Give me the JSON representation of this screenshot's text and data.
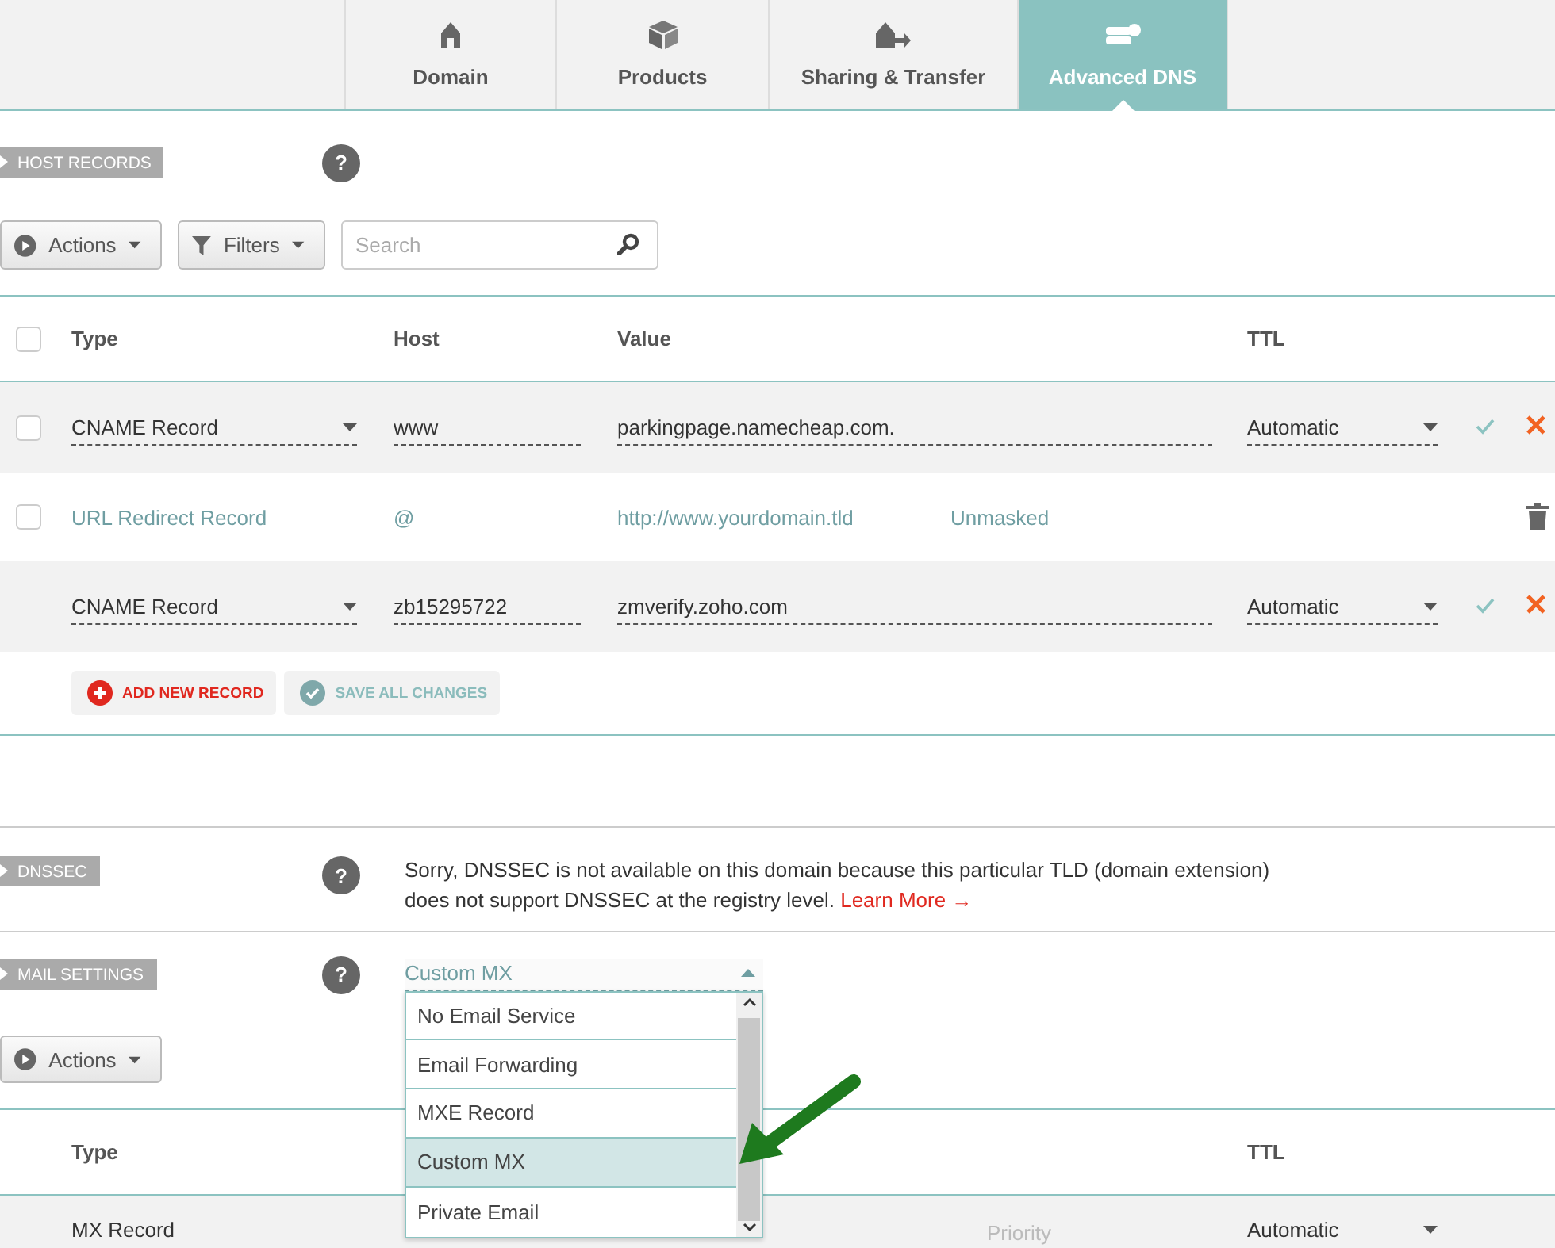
{
  "tabs": [
    {
      "label": "Domain",
      "selected": false
    },
    {
      "label": "Products",
      "selected": false
    },
    {
      "label": "Sharing & Transfer",
      "selected": false
    },
    {
      "label": "Advanced DNS",
      "selected": true
    }
  ],
  "host_records": {
    "title": "HOST RECORDS",
    "help": "?",
    "actions_button": "Actions",
    "filters_button": "Filters",
    "search": {
      "placeholder": "Search"
    },
    "header_checkbox": {
      "checked": false
    },
    "columns": [
      "Type",
      "Host",
      "Value",
      "TTL"
    ],
    "rows": [
      {
        "kind": "edit",
        "checked": false,
        "type": "CNAME Record",
        "host": "www",
        "value": "parkingpage.namecheap.com.",
        "ttl": "Automatic"
      },
      {
        "kind": "view",
        "checked": false,
        "type": "URL Redirect Record",
        "host": "@",
        "value": "http://www.yourdomain.tld",
        "extra": "Unmasked"
      },
      {
        "kind": "edit",
        "type": "CNAME Record",
        "host": "zb15295722",
        "value": "zmverify.zoho.com",
        "ttl": "Automatic"
      }
    ],
    "add_button": "ADD NEW RECORD",
    "save_button": {
      "label": "SAVE ALL CHANGES",
      "disabled": true
    }
  },
  "dnssec": {
    "title": "DNSSEC",
    "help": "?",
    "text": "Sorry, DNSSEC is not available on this domain because this particular TLD (domain extension) does not support DNSSEC at the registry level.",
    "link": "Learn More →"
  },
  "mail_settings": {
    "title": "MAIL SETTINGS",
    "help": "?",
    "select": {
      "value": "Custom MX",
      "expanded": true,
      "options": [
        {
          "label": "No Email Service",
          "selected": false
        },
        {
          "label": "Email Forwarding",
          "selected": false
        },
        {
          "label": "MXE Record",
          "selected": false
        },
        {
          "label": "Custom MX",
          "selected": true
        },
        {
          "label": "Private Email",
          "selected": false
        }
      ]
    },
    "actions_button": "Actions",
    "columns": [
      "Type",
      "TTL"
    ],
    "rows": [
      {
        "type": "MX Record",
        "priority": {
          "placeholder": "Priority"
        },
        "ttl": "Automatic"
      }
    ]
  }
}
